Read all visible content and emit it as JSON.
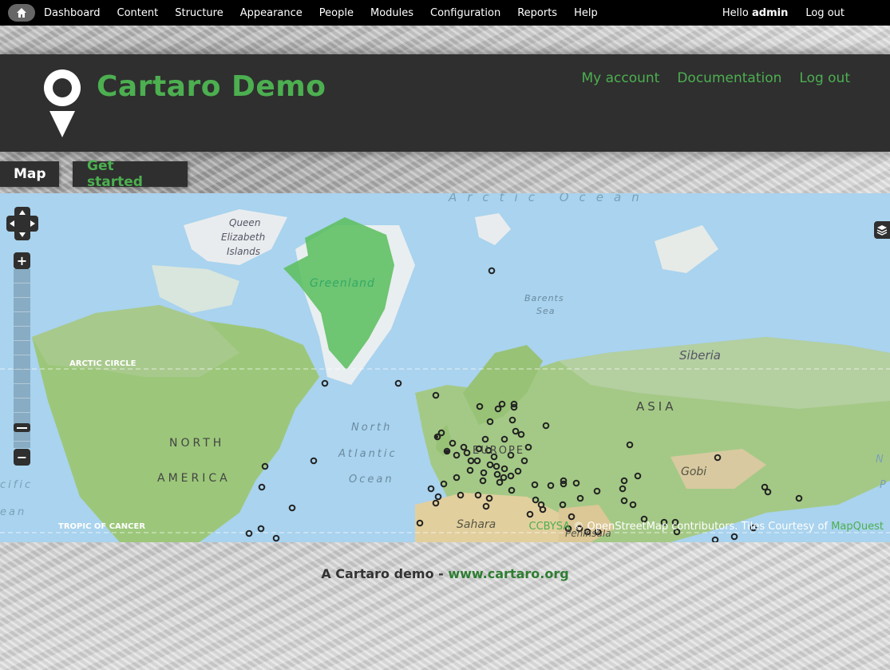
{
  "toolbar": {
    "menu": [
      "Dashboard",
      "Content",
      "Structure",
      "Appearance",
      "People",
      "Modules",
      "Configuration",
      "Reports",
      "Help"
    ],
    "hello_prefix": "Hello ",
    "username": "admin",
    "logout": "Log out"
  },
  "header": {
    "site_name": "Cartaro Demo",
    "secondary_menu": [
      "My account",
      "Documentation",
      "Log out"
    ]
  },
  "tabs": {
    "map": "Map",
    "get_started": "Get started"
  },
  "map": {
    "labels": {
      "arctic_ocean": "Arctic Ocean",
      "queen": "Queen",
      "elizabeth": "Elizabeth",
      "islands": "Islands",
      "greenland": "Greenland",
      "barents": "Barents",
      "sea": "Sea",
      "siberia": "Siberia",
      "arctic_circle": "ARCTIC CIRCLE",
      "asia": "ASIA",
      "north_label": "North",
      "atlantic": "Atlantic",
      "ocean": "Ocean",
      "north_america_1": "NORTH",
      "north_america_2": "AMERICA",
      "europe": "EUROPE",
      "gobi": "Gobi",
      "sahara": "Sahara",
      "peninsula": "Peninsula",
      "tropic": "TROPIC OF CANCER",
      "pacific": "cific",
      "ocean_left": "ean",
      "n_right": "N",
      "p_right": "P"
    },
    "zoom_in": "+",
    "zoom_out": "−",
    "attribution": {
      "license": "CCBYSA",
      "copy": " © OpenStreetMap contributors. Tiles Courtesy of ",
      "mapquest": "MapQuest"
    },
    "colors": {
      "polygon": "#5cbf60",
      "water": "#a9d3ee",
      "land": "#9cc77a"
    }
  },
  "footer": {
    "text": "A Cartaro demo - ",
    "link": "www.cartaro.org"
  }
}
